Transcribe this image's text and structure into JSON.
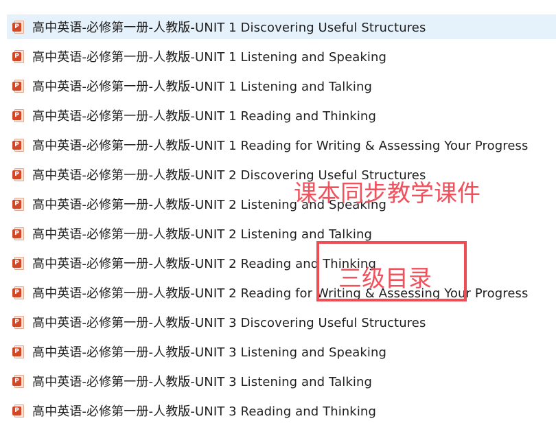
{
  "files": [
    {
      "name": "高中英语-必修第一册-人教版-UNIT 1 Discovering Useful Structures",
      "icon": "ppt-file-icon",
      "selected": true
    },
    {
      "name": "高中英语-必修第一册-人教版-UNIT 1 Listening and Speaking",
      "icon": "ppt-file-icon"
    },
    {
      "name": "高中英语-必修第一册-人教版-UNIT 1 Listening and Talking",
      "icon": "ppt-file-icon"
    },
    {
      "name": "高中英语-必修第一册-人教版-UNIT 1 Reading and Thinking",
      "icon": "ppt-file-icon"
    },
    {
      "name": "高中英语-必修第一册-人教版-UNIT 1 Reading for Writing & Assessing Your Progress",
      "icon": "ppt-file-icon"
    },
    {
      "name": "高中英语-必修第一册-人教版-UNIT 2 Discovering Useful Structures",
      "icon": "ppt-file-icon"
    },
    {
      "name": "高中英语-必修第一册-人教版-UNIT 2 Listening and Speaking",
      "icon": "ppt-file-icon"
    },
    {
      "name": "高中英语-必修第一册-人教版-UNIT 2 Listening and Talking",
      "icon": "ppt-file-icon"
    },
    {
      "name": "高中英语-必修第一册-人教版-UNIT 2 Reading and Thinking",
      "icon": "ppt-file-icon"
    },
    {
      "name": "高中英语-必修第一册-人教版-UNIT 2 Reading for Writing & Assessing Your Progress",
      "icon": "ppt-file-icon"
    },
    {
      "name": "高中英语-必修第一册-人教版-UNIT 3 Discovering Useful Structures",
      "icon": "ppt-file-icon"
    },
    {
      "name": "高中英语-必修第一册-人教版-UNIT 3 Listening and Speaking",
      "icon": "ppt-file-icon"
    },
    {
      "name": "高中英语-必修第一册-人教版-UNIT 3 Listening and Talking",
      "icon": "ppt-file-icon"
    },
    {
      "name": "高中英语-必修第一册-人教版-UNIT 3 Reading and Thinking",
      "icon": "ppt-file-icon"
    }
  ],
  "overlay": {
    "caption": "课本同步教学课件",
    "boxed_caption": "三级目录",
    "color": "#f0515c"
  },
  "colors": {
    "selected_row": "#e5f1fb",
    "ppt_badge": "#d24726",
    "ppt_badge_letter": "P"
  }
}
